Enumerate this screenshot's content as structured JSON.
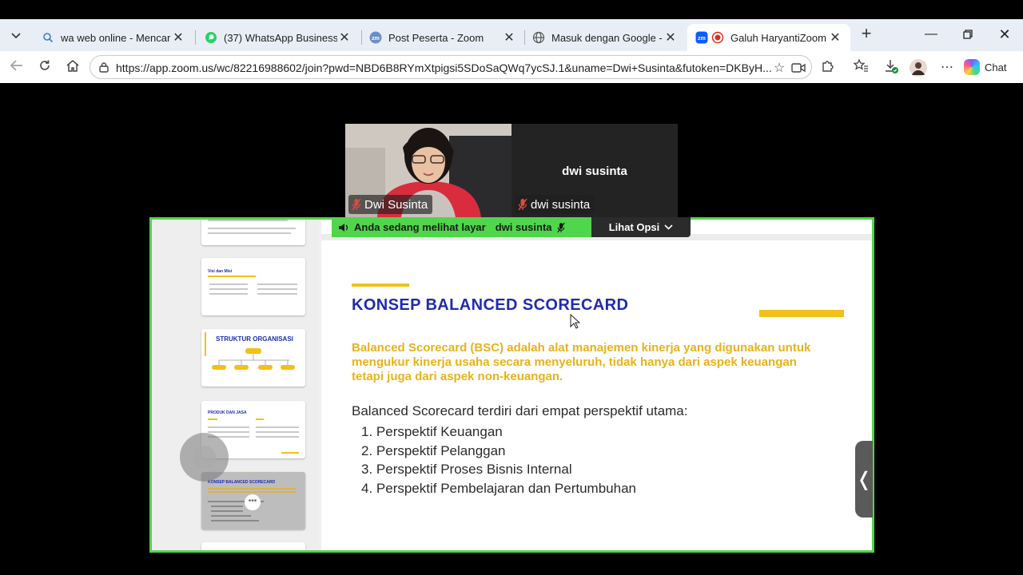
{
  "browser": {
    "tabs": [
      {
        "title": "wa web online - Mencari",
        "icon": "search-icon"
      },
      {
        "title": "(37) WhatsApp Business",
        "icon": "whatsapp-icon"
      },
      {
        "title": "Post Peserta - Zoom",
        "icon": "zoom-icon"
      },
      {
        "title": "Masuk dengan Google - Zoom",
        "icon": "globe-icon"
      },
      {
        "title": "Galuh HaryantiZoom M",
        "icon": "zoom-icon"
      }
    ],
    "url": "https://app.zoom.us/wc/82216988602/join?pwd=NBD6B8RYmXtpigsi5SDoSaQWq7ycSJ.1&uname=Dwi+Susinta&futoken=DKByH...",
    "chat_label": "Chat"
  },
  "meeting": {
    "participants": [
      {
        "name_tag": "Dwi Susinta",
        "has_video": true
      },
      {
        "name_tag": "dwi susinta",
        "display_name": "dwi susinta",
        "has_video": false
      }
    ],
    "share_banner": {
      "label": "Anda sedang melihat layar",
      "presenter": "dwi susinta"
    },
    "options_label": "Lihat Opsi",
    "collapse_glyph": "❬"
  },
  "thumbnails": [
    {
      "title": ""
    },
    {
      "title": "Visi dan Misi"
    },
    {
      "title": "STRUKTUR ORGANISASI"
    },
    {
      "title": "PRODUK DAN JASA"
    },
    {
      "title": "KONSEP BALANCED SCORECARD"
    },
    {
      "title": ""
    }
  ],
  "slide": {
    "title": "KONSEP BALANCED SCORECARD",
    "definition": "Balanced Scorecard (BSC) adalah alat manajemen kinerja yang digunakan untuk mengukur kinerja usaha secara menyeluruh, tidak hanya dari aspek keuangan tetapi juga dari aspek non-keuangan.",
    "intro": "Balanced Scorecard terdiri dari empat perspektif utama:",
    "items": [
      "1. Perspektif Keuangan",
      "2. Perspektif Pelanggan",
      "3. Perspektif Proses Bisnis Internal",
      "4. Perspektif Pembelajaran dan Pertumbuhan"
    ]
  },
  "colors": {
    "share_border": "#4fd64b",
    "slide_title": "#1f2bb0",
    "slide_accent": "#e9b21a"
  }
}
